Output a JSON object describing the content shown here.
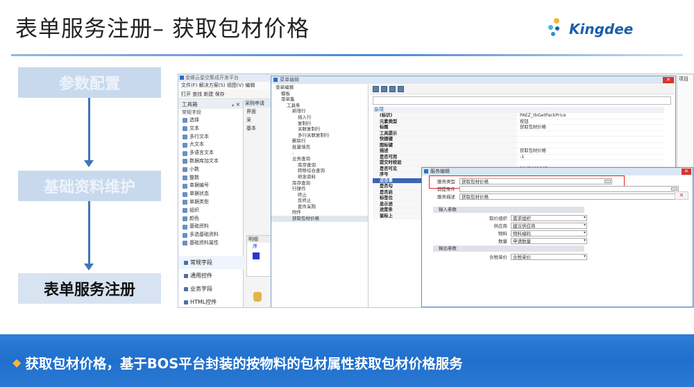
{
  "slide": {
    "title": "表单服务注册– 获取包材价格",
    "logo_text": "Kingdee",
    "banner_text": "获取包材价格，基于BOS平台封装的按物料的包材属性获取包材价格服务",
    "colors": {
      "accent": "#1f6fcc",
      "flow": "#3d76b8",
      "highlight": "#e2231a",
      "diamond": "#f6b73c"
    }
  },
  "flow": [
    {
      "label": "参数配置",
      "active": false
    },
    {
      "label": "基础资料维护",
      "active": false
    },
    {
      "label": "表单服务注册",
      "active": true
    }
  ],
  "app": {
    "title": "金蝶云星空集成开发平台",
    "menus": "文件(F)  解决方案(S)  视图(V)  编辑",
    "toolbar": "打开  查找  新建  保存",
    "toolbox_title": "工具箱",
    "toolbox_group": "常规字段",
    "toolbox_items": [
      "选择",
      "文本",
      "多行文本",
      "大文本",
      "多语言文本",
      "数据库加文本",
      "小数",
      "整数",
      "单据编号",
      "单据状态",
      "单据类型",
      "组织",
      "颜色",
      "基础资料",
      "多选基础资料",
      "基础资料属性"
    ],
    "toolbox_tabs": [
      "常规字段",
      "通用控件",
      "业务字段",
      "HTML控件"
    ],
    "mid_tab": "采购申请",
    "mid_rows": [
      "界面",
      "采",
      "基本"
    ],
    "mid_detail": "明细",
    "mid_seq": "序"
  },
  "menu_editor": {
    "title": "菜单编辑",
    "tree": [
      "菜单编辑",
      "模板",
      "菜单集",
      "工具条",
      "新增行",
      "插入行",
      "复制行",
      "关联复制行",
      "多行关联复制行",
      "删除行",
      "批量填充",
      "-",
      "业务查询",
      "库存查询",
      "转移综合查询",
      "研发资料",
      "库存查询",
      "行操作",
      "终止",
      "反终止",
      "套件采购",
      "附件",
      "获取包材价格"
    ],
    "cat_label": "杂项",
    "props": [
      {
        "k": "(标识)",
        "v": "PAEZ_tbGetPackPrice"
      },
      {
        "k": "元素类型",
        "v": "按钮"
      },
      {
        "k": "标题",
        "v": "获取包材价格"
      },
      {
        "k": "工具提示",
        "v": ""
      },
      {
        "k": "快捷键",
        "v": ""
      },
      {
        "k": "图标键",
        "v": ""
      },
      {
        "k": "描述",
        "v": "获取包材价格"
      },
      {
        "k": "是否可用",
        "v": "-1"
      },
      {
        "k": "提交时校验",
        "v": ""
      },
      {
        "k": "是否可见",
        "v": "2147483647"
      },
      {
        "k": "序号",
        "v": ""
      },
      {
        "k": "点击事",
        "v": ""
      },
      {
        "k": "是否勾",
        "v": ""
      },
      {
        "k": "是否启",
        "v": ""
      },
      {
        "k": "标签位",
        "v": ""
      },
      {
        "k": "显示进",
        "v": ""
      },
      {
        "k": "进度条",
        "v": ""
      },
      {
        "k": "鼠标上",
        "v": ""
      }
    ],
    "right_label": "项目"
  },
  "service_dialog": {
    "title": "服务编辑",
    "service_type_label": "服务类型",
    "service_type_value": "获取包材价格",
    "precond_label": "前提条件",
    "desc_label": "服务描述",
    "desc_value": "获取包材价格",
    "input_section": "输入参数",
    "inputs": [
      {
        "label": "取价组织",
        "value": "需求组织"
      },
      {
        "label": "供应商",
        "value": "建议供应商"
      },
      {
        "label": "物料",
        "value": "物料编码"
      },
      {
        "label": "数量",
        "value": "申请数量"
      }
    ],
    "output_section": "输出参数",
    "outputs": [
      {
        "label": "含税单价",
        "value": "含税单价"
      }
    ],
    "ellipsis": "..."
  }
}
